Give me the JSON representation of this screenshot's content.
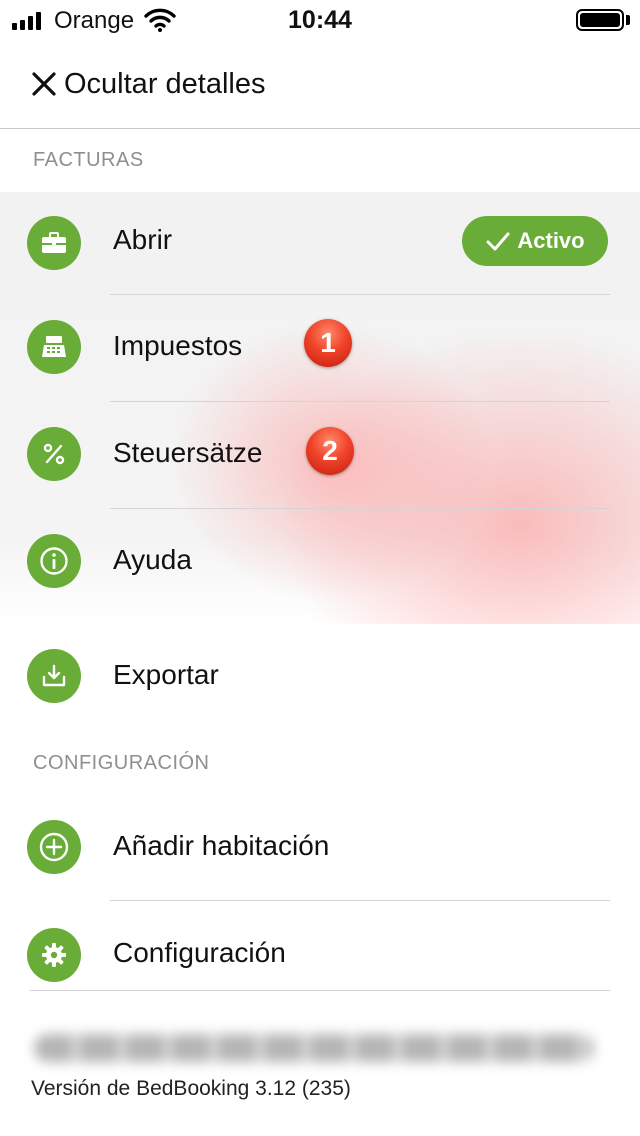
{
  "status_bar": {
    "carrier": "Orange",
    "time": "10:44"
  },
  "header": {
    "title": "Ocultar detalles"
  },
  "sections": {
    "invoices_label": "FACTURAS",
    "config_label": "CONFIGURACIÓN"
  },
  "menu": [
    {
      "label": "Abrir",
      "icon": "briefcase-icon"
    },
    {
      "label": "Impuestos",
      "icon": "cash-register-icon",
      "badge": "1"
    },
    {
      "label": "Steuersätze",
      "icon": "percent-icon",
      "badge": "2"
    },
    {
      "label": "Ayuda",
      "icon": "info-icon"
    },
    {
      "label": "Exportar",
      "icon": "download-icon"
    }
  ],
  "active_status": "Activo",
  "config_menu": [
    {
      "label": "Añadir habitación",
      "icon": "plus-icon"
    },
    {
      "label": "Configuración",
      "icon": "gear-icon"
    }
  ],
  "footer": {
    "version": "Versión de BedBooking 3.12 (235)"
  },
  "colors": {
    "accent_green": "#6aac38",
    "badge_red": "#f0432a"
  }
}
